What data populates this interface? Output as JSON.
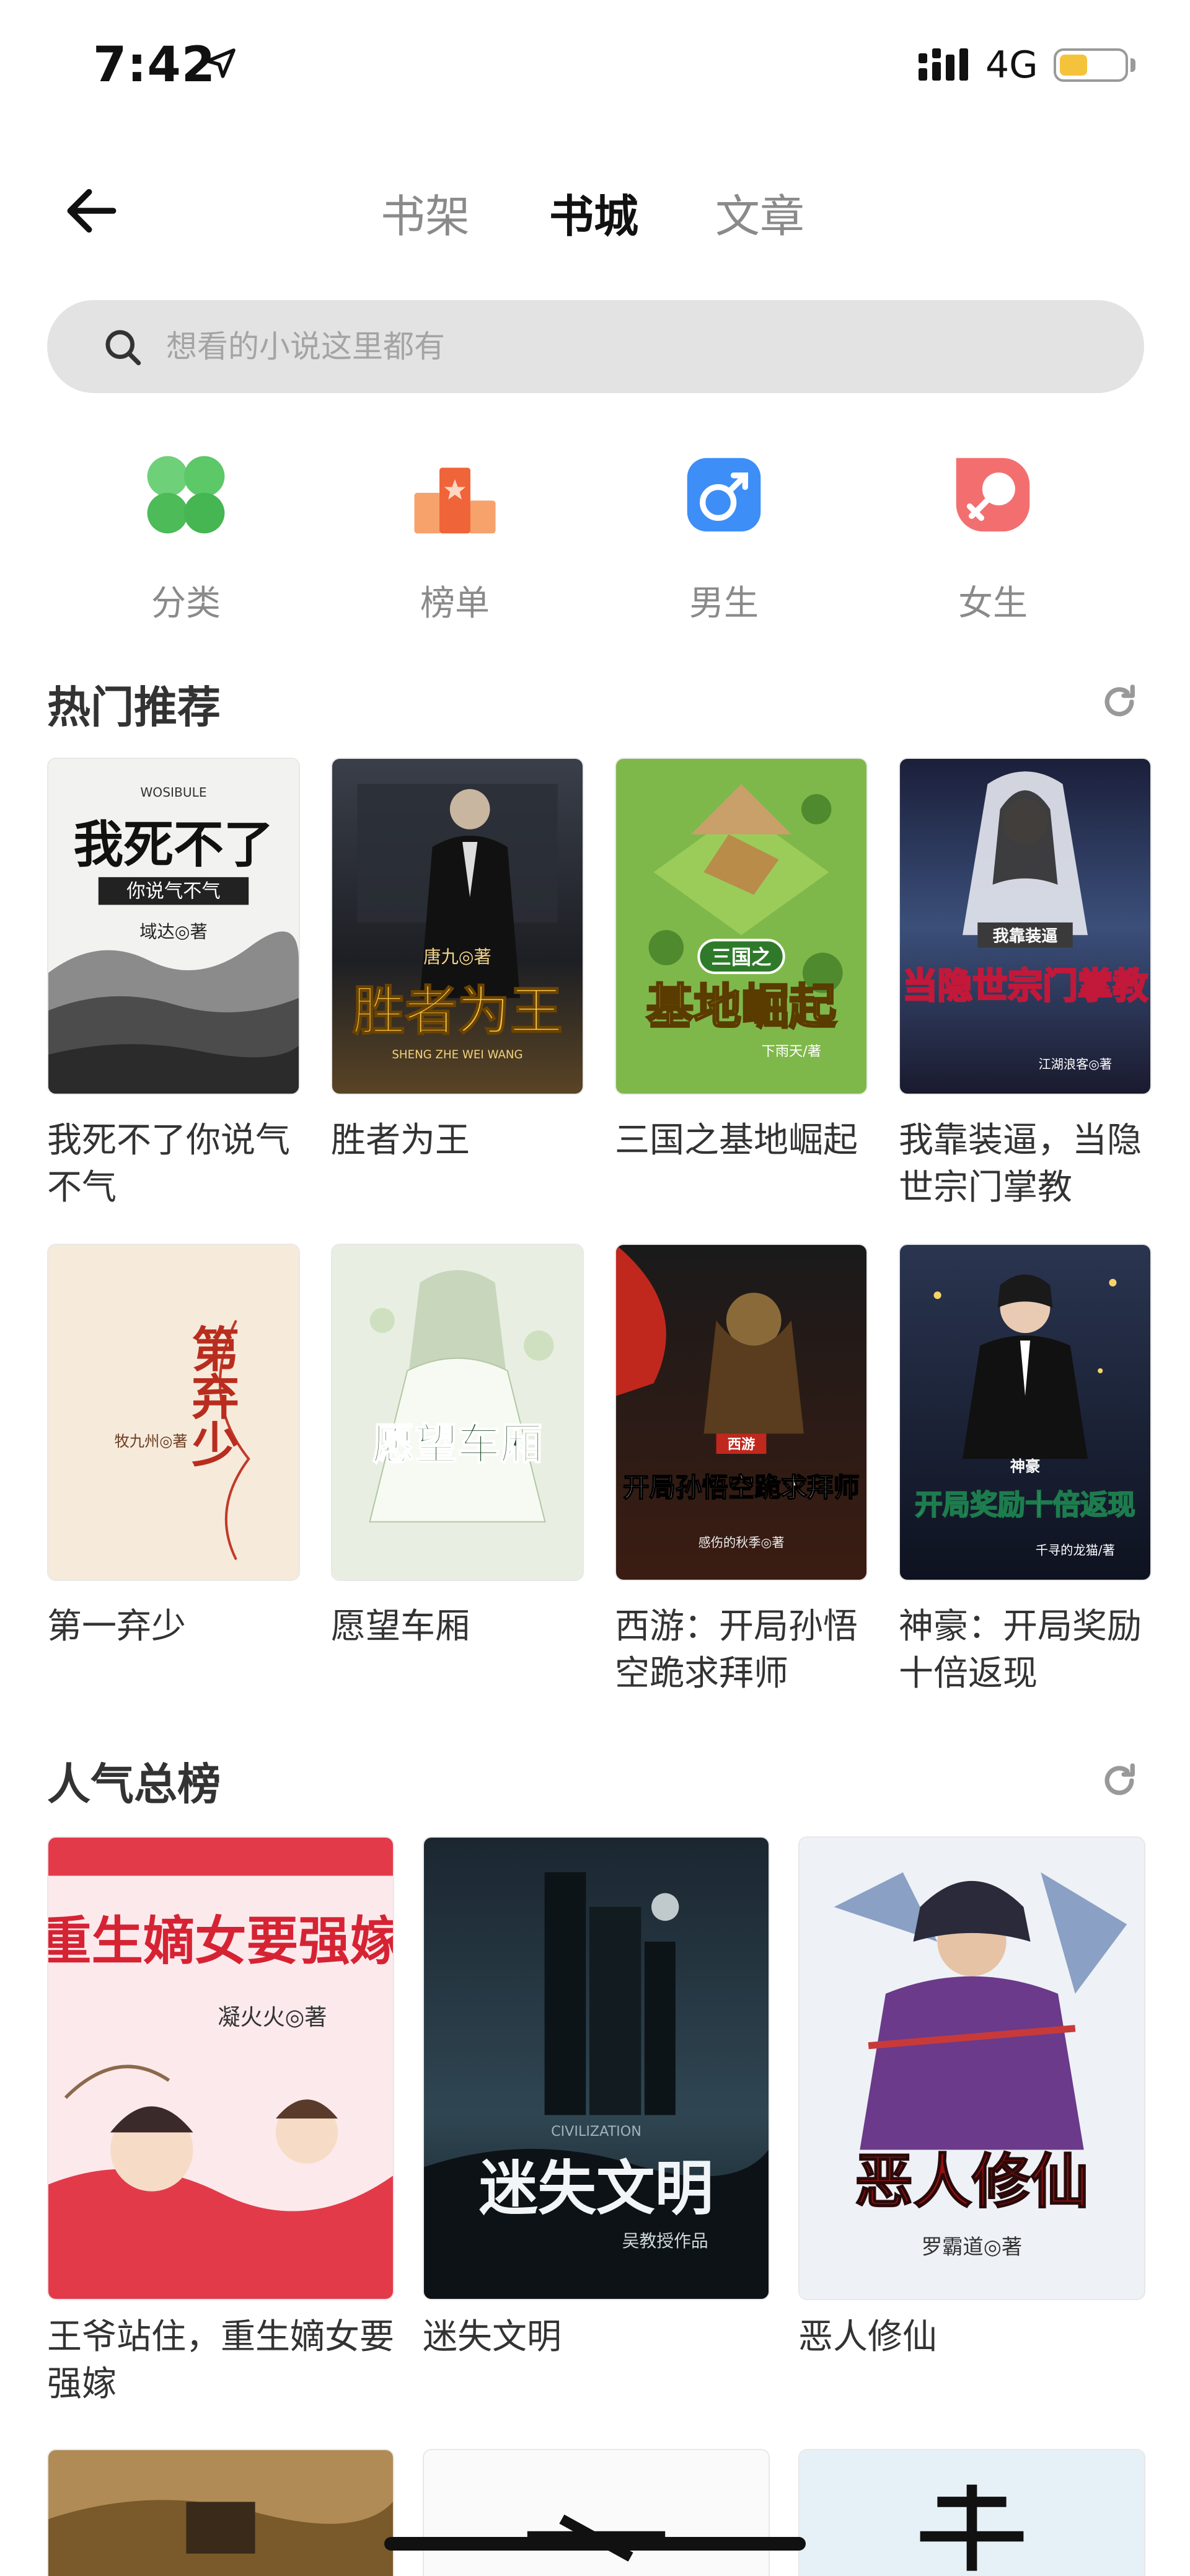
{
  "status_bar": {
    "time": "7:42",
    "network": "4G",
    "battery_color": "#f5c33b"
  },
  "nav": {
    "back_icon": "arrow-left-icon",
    "tabs": [
      {
        "label": "书架",
        "active": false
      },
      {
        "label": "书城",
        "active": true
      },
      {
        "label": "文章",
        "active": false
      }
    ]
  },
  "search": {
    "placeholder": "想看的小说这里都有",
    "icon": "search-icon"
  },
  "categories": [
    {
      "label": "分类",
      "icon": "clover-icon",
      "color": "#4cc15a"
    },
    {
      "label": "榜单",
      "icon": "podium-icon",
      "color": "#f06a3c"
    },
    {
      "label": "男生",
      "icon": "male-icon",
      "color": "#3d8ef7"
    },
    {
      "label": "女生",
      "icon": "female-icon",
      "color": "#f36f6f"
    }
  ],
  "hot": {
    "title": "热门推荐",
    "books": [
      {
        "title": "我死不了你说气不气",
        "cover_text": "我死不了",
        "cover_sub": "你说气不气",
        "author": "域达◎著",
        "cover_latin": "WOSIBULE"
      },
      {
        "title": "胜者为王",
        "cover_text": "胜者为王",
        "author": "唐九◎著",
        "cover_latin": "SHENG ZHE WEI WANG"
      },
      {
        "title": "三国之基地崛起",
        "cover_text": "基地崛起",
        "cover_sub": "三国之",
        "author": "下雨天/著"
      },
      {
        "title": "我靠装逼，当隐世宗门掌教",
        "cover_text": "当隐世宗门掌教",
        "cover_sub": "我靠装逼",
        "author": "江湖浪客◎著"
      },
      {
        "title": "第一弃少",
        "cover_text": "第弃少",
        "author": "牧九州◎著"
      },
      {
        "title": "愿望车厢",
        "cover_text": "愿望车厢"
      },
      {
        "title": "西游：开局孙悟空跪求拜师",
        "cover_text": "开局孙悟空跪求拜师",
        "cover_sub": "西游",
        "author": "感伤的秋季◎著"
      },
      {
        "title": "神豪：开局奖励十倍返现",
        "cover_text": "开局奖励十倍返现",
        "cover_sub": "神豪",
        "author": "千寻的龙猫/著"
      }
    ]
  },
  "popular": {
    "title": "人气总榜",
    "books": [
      {
        "title": "王爷站住，重生嫡女要强嫁",
        "cover_text": "重生嫡女要强嫁",
        "author": "凝火火◎著"
      },
      {
        "title": "迷失文明",
        "cover_text": "迷失文明",
        "author": "吴教授作品",
        "cover_latin": "CIVILIZATION"
      },
      {
        "title": "恶人修仙",
        "cover_text": "恶人修仙",
        "author": "罗霸道◎著"
      }
    ]
  }
}
